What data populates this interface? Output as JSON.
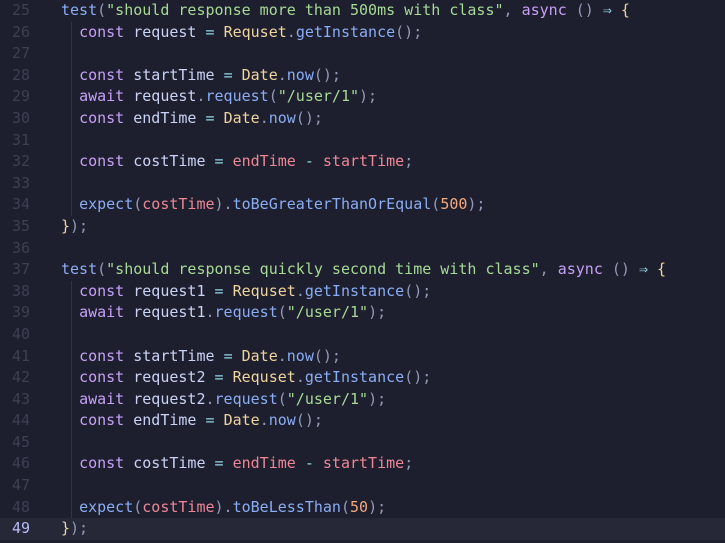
{
  "editor": {
    "active_line": 49,
    "colors": {
      "background": "#1e1f2e",
      "active_line": "#262838",
      "line_number": "#3c4053",
      "active_line_number": "#b7bdf8"
    },
    "token_colors": {
      "fn": "#8aadf4",
      "str": "#a6da95",
      "kw": "#c6a0f6",
      "var": "#cad3f5",
      "cls": "#eed49f",
      "num": "#f5a97f",
      "op": "#91d7e3",
      "red": "#ed8796",
      "plain": "#939ab7",
      "brace": "#eed49f"
    },
    "lines": [
      {
        "n": "25",
        "indent": 0,
        "guide": false,
        "tokens": [
          [
            "test",
            "fn"
          ],
          [
            "(",
            "plain"
          ],
          [
            "\"should response more than 500ms with class\"",
            "str"
          ],
          [
            ", ",
            "plain"
          ],
          [
            "async",
            "kw"
          ],
          [
            " () ",
            "plain"
          ],
          [
            "⇒",
            "op"
          ],
          [
            " {",
            "brace"
          ]
        ]
      },
      {
        "n": "26",
        "indent": 1,
        "guide": true,
        "tokens": [
          [
            "const",
            "kw"
          ],
          [
            " request ",
            "var"
          ],
          [
            "=",
            "op"
          ],
          [
            " ",
            "plain"
          ],
          [
            "Requset",
            "cls"
          ],
          [
            ".",
            "plain"
          ],
          [
            "getInstance",
            "fn"
          ],
          [
            "();",
            "plain"
          ]
        ]
      },
      {
        "n": "27",
        "indent": 1,
        "guide": true,
        "tokens": []
      },
      {
        "n": "28",
        "indent": 1,
        "guide": true,
        "tokens": [
          [
            "const",
            "kw"
          ],
          [
            " startTime ",
            "var"
          ],
          [
            "=",
            "op"
          ],
          [
            " ",
            "plain"
          ],
          [
            "Date",
            "cls"
          ],
          [
            ".",
            "plain"
          ],
          [
            "now",
            "fn"
          ],
          [
            "();",
            "plain"
          ]
        ]
      },
      {
        "n": "29",
        "indent": 1,
        "guide": true,
        "tokens": [
          [
            "await",
            "kw"
          ],
          [
            " request",
            "var"
          ],
          [
            ".",
            "plain"
          ],
          [
            "request",
            "fn"
          ],
          [
            "(",
            "plain"
          ],
          [
            "\"/user/1\"",
            "str"
          ],
          [
            ");",
            "plain"
          ]
        ]
      },
      {
        "n": "30",
        "indent": 1,
        "guide": true,
        "tokens": [
          [
            "const",
            "kw"
          ],
          [
            " endTime ",
            "var"
          ],
          [
            "=",
            "op"
          ],
          [
            " ",
            "plain"
          ],
          [
            "Date",
            "cls"
          ],
          [
            ".",
            "plain"
          ],
          [
            "now",
            "fn"
          ],
          [
            "();",
            "plain"
          ]
        ]
      },
      {
        "n": "31",
        "indent": 1,
        "guide": true,
        "tokens": []
      },
      {
        "n": "32",
        "indent": 1,
        "guide": true,
        "tokens": [
          [
            "const",
            "kw"
          ],
          [
            " costTime ",
            "var"
          ],
          [
            "=",
            "op"
          ],
          [
            " ",
            "plain"
          ],
          [
            "endTime",
            "red"
          ],
          [
            " ",
            "plain"
          ],
          [
            "-",
            "op"
          ],
          [
            " ",
            "plain"
          ],
          [
            "startTime",
            "red"
          ],
          [
            ";",
            "plain"
          ]
        ]
      },
      {
        "n": "33",
        "indent": 1,
        "guide": true,
        "tokens": []
      },
      {
        "n": "34",
        "indent": 1,
        "guide": true,
        "tokens": [
          [
            "expect",
            "fn"
          ],
          [
            "(",
            "plain"
          ],
          [
            "costTime",
            "red"
          ],
          [
            ").",
            "plain"
          ],
          [
            "toBeGreaterThanOrEqual",
            "fn"
          ],
          [
            "(",
            "plain"
          ],
          [
            "500",
            "num"
          ],
          [
            ");",
            "plain"
          ]
        ]
      },
      {
        "n": "35",
        "indent": 0,
        "guide": false,
        "tokens": [
          [
            "}",
            "brace"
          ],
          [
            ");",
            "plain"
          ]
        ]
      },
      {
        "n": "36",
        "indent": 0,
        "guide": false,
        "tokens": []
      },
      {
        "n": "37",
        "indent": 0,
        "guide": false,
        "tokens": [
          [
            "test",
            "fn"
          ],
          [
            "(",
            "plain"
          ],
          [
            "\"should response quickly second time with class\"",
            "str"
          ],
          [
            ", ",
            "plain"
          ],
          [
            "async",
            "kw"
          ],
          [
            " () ",
            "plain"
          ],
          [
            "⇒",
            "op"
          ],
          [
            " {",
            "brace"
          ]
        ]
      },
      {
        "n": "38",
        "indent": 1,
        "guide": true,
        "tokens": [
          [
            "const",
            "kw"
          ],
          [
            " request1 ",
            "var"
          ],
          [
            "=",
            "op"
          ],
          [
            " ",
            "plain"
          ],
          [
            "Requset",
            "cls"
          ],
          [
            ".",
            "plain"
          ],
          [
            "getInstance",
            "fn"
          ],
          [
            "();",
            "plain"
          ]
        ]
      },
      {
        "n": "39",
        "indent": 1,
        "guide": true,
        "tokens": [
          [
            "await",
            "kw"
          ],
          [
            " request1",
            "var"
          ],
          [
            ".",
            "plain"
          ],
          [
            "request",
            "fn"
          ],
          [
            "(",
            "plain"
          ],
          [
            "\"/user/1\"",
            "str"
          ],
          [
            ");",
            "plain"
          ]
        ]
      },
      {
        "n": "40",
        "indent": 1,
        "guide": true,
        "tokens": []
      },
      {
        "n": "41",
        "indent": 1,
        "guide": true,
        "tokens": [
          [
            "const",
            "kw"
          ],
          [
            " startTime ",
            "var"
          ],
          [
            "=",
            "op"
          ],
          [
            " ",
            "plain"
          ],
          [
            "Date",
            "cls"
          ],
          [
            ".",
            "plain"
          ],
          [
            "now",
            "fn"
          ],
          [
            "();",
            "plain"
          ]
        ]
      },
      {
        "n": "42",
        "indent": 1,
        "guide": true,
        "tokens": [
          [
            "const",
            "kw"
          ],
          [
            " request2 ",
            "var"
          ],
          [
            "=",
            "op"
          ],
          [
            " ",
            "plain"
          ],
          [
            "Requset",
            "cls"
          ],
          [
            ".",
            "plain"
          ],
          [
            "getInstance",
            "fn"
          ],
          [
            "();",
            "plain"
          ]
        ]
      },
      {
        "n": "43",
        "indent": 1,
        "guide": true,
        "tokens": [
          [
            "await",
            "kw"
          ],
          [
            " request2",
            "var"
          ],
          [
            ".",
            "plain"
          ],
          [
            "request",
            "fn"
          ],
          [
            "(",
            "plain"
          ],
          [
            "\"/user/1\"",
            "str"
          ],
          [
            ");",
            "plain"
          ]
        ]
      },
      {
        "n": "44",
        "indent": 1,
        "guide": true,
        "tokens": [
          [
            "const",
            "kw"
          ],
          [
            " endTime ",
            "var"
          ],
          [
            "=",
            "op"
          ],
          [
            " ",
            "plain"
          ],
          [
            "Date",
            "cls"
          ],
          [
            ".",
            "plain"
          ],
          [
            "now",
            "fn"
          ],
          [
            "();",
            "plain"
          ]
        ]
      },
      {
        "n": "45",
        "indent": 1,
        "guide": true,
        "tokens": []
      },
      {
        "n": "46",
        "indent": 1,
        "guide": true,
        "tokens": [
          [
            "const",
            "kw"
          ],
          [
            " costTime ",
            "var"
          ],
          [
            "=",
            "op"
          ],
          [
            " ",
            "plain"
          ],
          [
            "endTime",
            "red"
          ],
          [
            " ",
            "plain"
          ],
          [
            "-",
            "op"
          ],
          [
            " ",
            "plain"
          ],
          [
            "startTime",
            "red"
          ],
          [
            ";",
            "plain"
          ]
        ]
      },
      {
        "n": "47",
        "indent": 1,
        "guide": true,
        "tokens": []
      },
      {
        "n": "48",
        "indent": 1,
        "guide": true,
        "tokens": [
          [
            "expect",
            "fn"
          ],
          [
            "(",
            "plain"
          ],
          [
            "costTime",
            "red"
          ],
          [
            ").",
            "plain"
          ],
          [
            "toBeLessThan",
            "fn"
          ],
          [
            "(",
            "plain"
          ],
          [
            "50",
            "num"
          ],
          [
            ");",
            "plain"
          ]
        ]
      },
      {
        "n": "49",
        "indent": 0,
        "guide": false,
        "tokens": [
          [
            "}",
            "brace"
          ],
          [
            ");",
            "plain"
          ]
        ]
      }
    ]
  }
}
